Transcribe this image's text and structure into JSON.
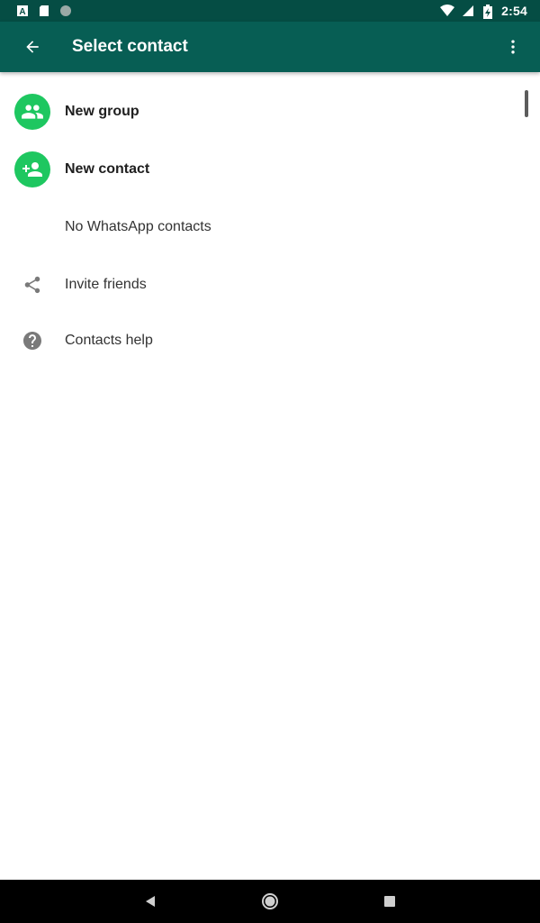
{
  "status_bar": {
    "time": "2:54",
    "left_icons": [
      "a-notification-icon",
      "sd-card-icon",
      "sync-circle-icon"
    ],
    "right_icons": [
      "wifi-icon",
      "signal-icon",
      "battery-charging-icon"
    ]
  },
  "app_bar": {
    "title": "Select contact",
    "back_icon": "arrow-back-icon",
    "menu_icon": "more-vert-icon",
    "color": "#075e54"
  },
  "list": {
    "new_group": "New group",
    "new_contact": "New contact",
    "no_contacts": "No WhatsApp contacts",
    "invite_friends": "Invite friends",
    "contacts_help": "Contacts help",
    "accent": "#1ec760"
  },
  "nav_bar": {
    "back": "nav-back-icon",
    "home": "nav-home-icon",
    "recents": "nav-recents-icon"
  }
}
